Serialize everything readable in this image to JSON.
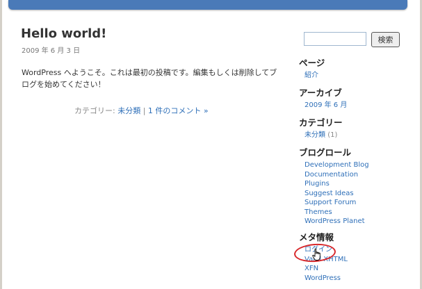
{
  "post": {
    "title": "Hello world!",
    "date": "2009 年 6 月 3 日",
    "body": "WordPress へようこそ。これは最初の投稿です。編集もしくは削除してブログを始めてください！",
    "meta_prefix": "カテゴリー: ",
    "category": "未分類",
    "separator": " | ",
    "comments": "1 件のコメント »"
  },
  "search": {
    "button_label": "検索",
    "value": ""
  },
  "sidebar": {
    "pages": {
      "title": "ページ",
      "items": [
        "紹介"
      ]
    },
    "archives": {
      "title": "アーカイブ",
      "items": [
        "2009 年 6 月"
      ]
    },
    "categories": {
      "title": "カテゴリー",
      "item_label": "未分類",
      "item_count": "(1)"
    },
    "blogroll": {
      "title": "ブログロール",
      "items": [
        "Development Blog",
        "Documentation",
        "Plugins",
        "Suggest Ideas",
        "Support Forum",
        "Themes",
        "WordPress Planet"
      ]
    },
    "meta": {
      "title": "メタ情報",
      "items": [
        "ログイン",
        "Valid XHTML",
        "XFN",
        "WordPress"
      ]
    }
  },
  "colors": {
    "header": "#4a7ab8",
    "link": "#2e6fb8",
    "highlight": "#d8282b"
  },
  "icons": {
    "cursor": "hand-pointer-icon"
  }
}
